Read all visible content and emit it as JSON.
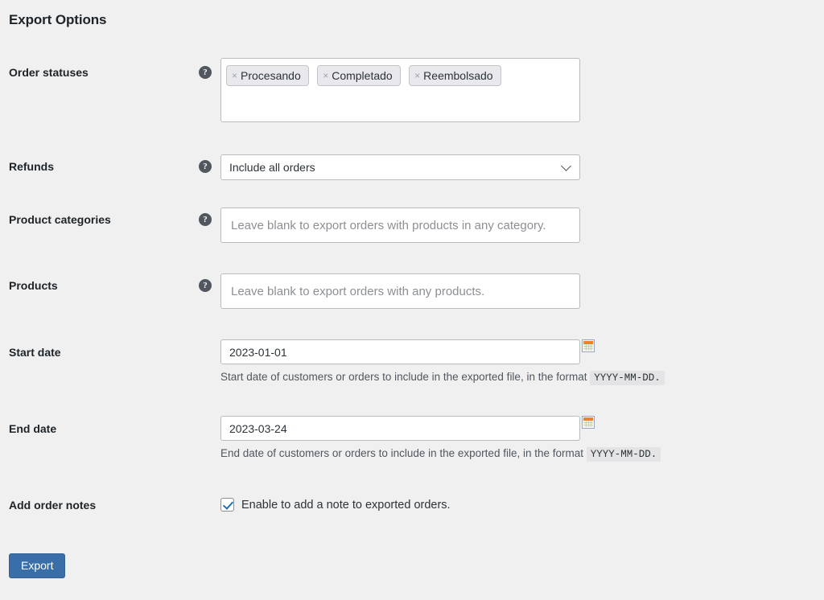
{
  "page": {
    "title": "Export Options"
  },
  "icons": {
    "help": "?",
    "tag_remove": "×",
    "calendar": "calendar-icon",
    "chevron_down": "chevron-down-icon",
    "check": "check-icon"
  },
  "colors": {
    "background": "#f0f0f1",
    "text": "#1d2327",
    "muted_text": "#50575e",
    "placeholder": "#8c8f94",
    "field_border": "#b8bcc0",
    "accent_blue": "#2271b1",
    "button_blue": "#3a6ea8",
    "tag_background": "#e9e9ed",
    "code_background": "#e4e4e6",
    "help_icon": "#50575e"
  },
  "fields": {
    "order_statuses": {
      "label": "Order statuses",
      "help": "?",
      "tags": [
        {
          "label": "Procesando",
          "remove": "×"
        },
        {
          "label": "Completado",
          "remove": "×"
        },
        {
          "label": "Reembolsado",
          "remove": "×"
        }
      ]
    },
    "refunds": {
      "label": "Refunds",
      "help": "?",
      "selected": "Include all orders"
    },
    "product_categories": {
      "label": "Product categories",
      "help": "?",
      "value": "",
      "placeholder": "Leave blank to export orders with products in any category."
    },
    "products": {
      "label": "Products",
      "help": "?",
      "value": "",
      "placeholder": "Leave blank to export orders with any products."
    },
    "start_date": {
      "label": "Start date",
      "value": "2023-01-01",
      "description_prefix": "Start date of customers or orders to include in the exported file, in the format",
      "description_code": "YYYY-MM-DD."
    },
    "end_date": {
      "label": "End date",
      "value": "2023-03-24",
      "description_prefix": "End date of customers or orders to include in the exported file, in the format",
      "description_code": "YYYY-MM-DD."
    },
    "add_order_notes": {
      "label": "Add order notes",
      "checked": true,
      "checkbox_label": "Enable to add a note to exported orders."
    }
  },
  "actions": {
    "export_label": "Export"
  }
}
